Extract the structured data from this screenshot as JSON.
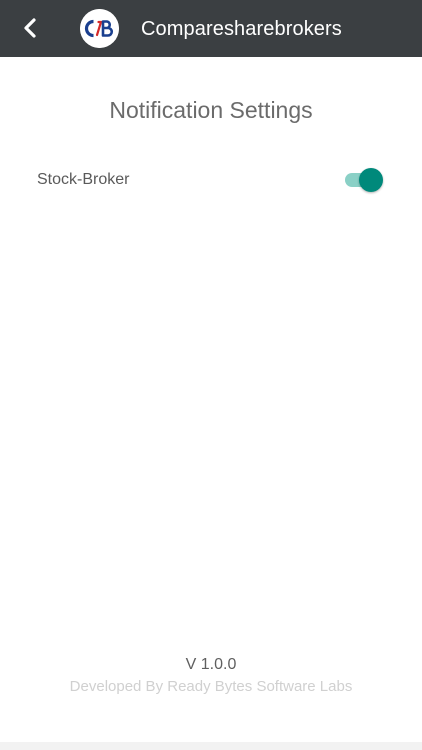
{
  "appbar": {
    "title": "Comparesharebrokers",
    "back_icon": "chevron-left-icon",
    "logo_text": "CSB",
    "background": "#3b3f42"
  },
  "page": {
    "title": "Notification Settings"
  },
  "settings": [
    {
      "label": "Stock-Broker",
      "enabled": true,
      "accent": "#00897b"
    }
  ],
  "footer": {
    "version": "V 1.0.0",
    "credit": "Developed By Ready Bytes Software Labs"
  }
}
